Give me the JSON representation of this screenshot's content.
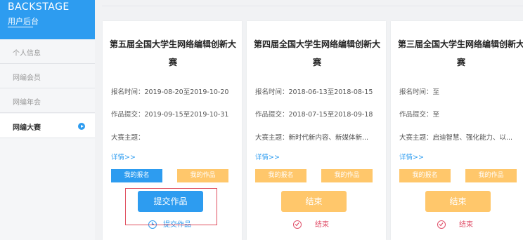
{
  "sidebar": {
    "brand": "BACKSTAGE",
    "subtitle": "用户后台",
    "items": [
      {
        "label": "个人信息"
      },
      {
        "label": "网编会员"
      },
      {
        "label": "网编年会"
      },
      {
        "label": "网编大赛"
      }
    ]
  },
  "colors": {
    "accent": "#2d9cf0",
    "orange": "#ffc76b",
    "danger": "#e0506a"
  },
  "cards": [
    {
      "title": "第五届全国大学生网络编辑创新大赛",
      "reg_time": "报名时间：2019-08-20至2019-10-20",
      "submit_time": "作品提交：2019-09-15至2019-10-31",
      "theme": "大赛主题：",
      "details": "详情>>",
      "tab_enroll": "我的报名",
      "tab_works": "我的作品",
      "button": "提交作品",
      "status_icon": "clock-icon",
      "status": "提交作品"
    },
    {
      "title": "第四届全国大学生网络编辑创新大赛",
      "reg_time": "报名时间：2018-06-13至2018-08-15",
      "submit_time": "作品提交：2018-07-15至2018-09-18",
      "theme": "大赛主题：新时代新内容、新媒体新...",
      "details": "详情>>",
      "tab_enroll": "我的报名",
      "tab_works": "我的作品",
      "button": "结束",
      "status_icon": "check-circle-icon",
      "status": "结束"
    },
    {
      "title": "第三届全国大学生网络编辑创新大赛",
      "reg_time": "报名时间：至",
      "submit_time": "作品提交：至",
      "theme": "大赛主题：启迪智慧、强化能力、以...",
      "details": "详情>>",
      "tab_enroll": "我的报名",
      "tab_works": "我的作品",
      "button": "结束",
      "status_icon": "check-circle-icon",
      "status": "结束"
    }
  ]
}
